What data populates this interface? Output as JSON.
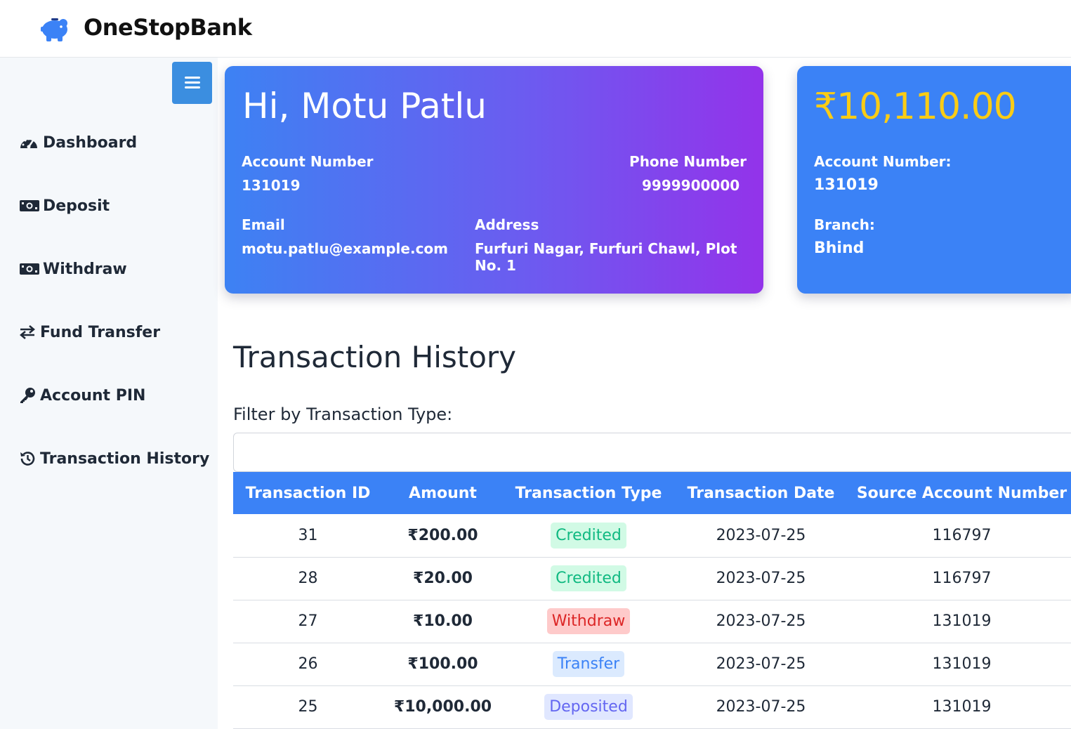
{
  "app": {
    "name": "OneStopBank",
    "logo_icon": "piggy-bank-icon"
  },
  "sidebar": {
    "toggle_icon": "hamburger-menu-icon",
    "items": [
      {
        "label": "Dashboard",
        "icon": "gauge-icon"
      },
      {
        "label": "Deposit",
        "icon": "money-bill-icon"
      },
      {
        "label": "Withdraw",
        "icon": "money-bill-icon"
      },
      {
        "label": "Fund Transfer",
        "icon": "arrows-exchange-icon"
      },
      {
        "label": "Account PIN",
        "icon": "key-icon"
      },
      {
        "label": "Transaction History",
        "icon": "history-icon"
      }
    ]
  },
  "profile": {
    "greeting": "Hi, Motu Patlu",
    "account_number_label": "Account Number",
    "account_number": "131019",
    "phone_label": "Phone Number",
    "phone": "9999900000",
    "email_label": "Email",
    "email": "motu.patlu@example.com",
    "address_label": "Address",
    "address": "Furfuri Nagar, Furfuri Chawl, Plot No. 1"
  },
  "balance_card": {
    "balance": "₹10,110.00",
    "account_number_label": "Account Number:",
    "account_number": "131019",
    "branch_label": "Branch:",
    "branch": "Bhind"
  },
  "history": {
    "title": "Transaction History",
    "filter_label": "Filter by Transaction Type:",
    "filter_value": "",
    "columns": [
      "Transaction ID",
      "Amount",
      "Transaction Type",
      "Transaction Date",
      "Source Account Number"
    ],
    "rows": [
      {
        "id": "31",
        "amount": "₹200.00",
        "type": "Credited",
        "date": "2023-07-25",
        "source": "116797"
      },
      {
        "id": "28",
        "amount": "₹20.00",
        "type": "Credited",
        "date": "2023-07-25",
        "source": "116797"
      },
      {
        "id": "27",
        "amount": "₹10.00",
        "type": "Withdraw",
        "date": "2023-07-25",
        "source": "131019"
      },
      {
        "id": "26",
        "amount": "₹100.00",
        "type": "Transfer",
        "date": "2023-07-25",
        "source": "131019"
      },
      {
        "id": "25",
        "amount": "₹10,000.00",
        "type": "Deposited",
        "date": "2023-07-25",
        "source": "131019"
      }
    ]
  },
  "colors": {
    "primary": "#3b82f6",
    "gradient_end": "#9333ea",
    "balance": "#facc15",
    "credited": "#10b981",
    "withdraw": "#dc2626",
    "deposited": "#6366f1"
  }
}
